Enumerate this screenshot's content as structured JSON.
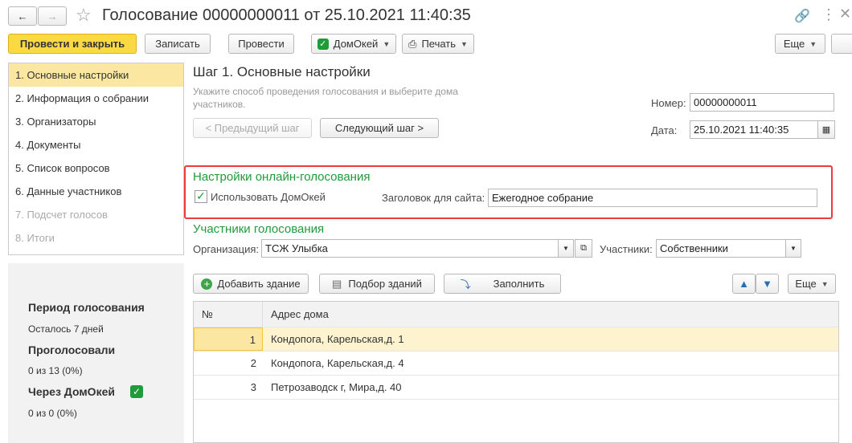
{
  "window": {
    "title": "Голосование 00000000011 от 25.10.2021 11:40:35"
  },
  "toolbar": {
    "post_close": "Провести и закрыть",
    "save": "Записать",
    "post": "Провести",
    "domokey": "ДомОкей",
    "print": "Печать",
    "more": "Еще"
  },
  "nav": {
    "items": [
      {
        "label": "1. Основные настройки"
      },
      {
        "label": "2. Информация о собрании"
      },
      {
        "label": "3. Организаторы"
      },
      {
        "label": "4. Документы"
      },
      {
        "label": "5. Список вопросов"
      },
      {
        "label": "6. Данные участников"
      },
      {
        "label": "7. Подсчет голосов"
      },
      {
        "label": "8. Итоги"
      }
    ]
  },
  "summary": {
    "period_title": "Период голосования",
    "period_value": "Осталось 7 дней",
    "voted_title": "Проголосовали",
    "voted_value": "0 из 13 (0%)",
    "via_title": "Через ДомОкей",
    "via_value": "0 из 0 (0%)"
  },
  "step": {
    "title": "Шаг 1. Основные настройки",
    "hint": "Укажите способ проведения голосования и выберите дома участников.",
    "prev": "< Предыдущий шаг",
    "next": "Следующий шаг >"
  },
  "doc": {
    "number_label": "Номер:",
    "number_value": "00000000011",
    "date_label": "Дата:",
    "date_value": "25.10.2021 11:40:35"
  },
  "online": {
    "title": "Настройки онлайн-голосования",
    "use_label": "Использовать ДомОкей",
    "use_checked": true,
    "header_label": "Заголовок для сайта:",
    "header_value": "Ежегодное собрание"
  },
  "participants": {
    "title": "Участники голосования",
    "org_label": "Организация:",
    "org_value": "ТСЖ Улыбка",
    "members_label": "Участники:",
    "members_value": "Собственники"
  },
  "table_toolbar": {
    "add": "Добавить здание",
    "select": "Подбор зданий",
    "fill": "Заполнить",
    "more": "Еще"
  },
  "table": {
    "headers": [
      "№",
      "Адрес дома"
    ],
    "rows": [
      {
        "n": "1",
        "address": "Кондопога, Карельская,д. 1"
      },
      {
        "n": "2",
        "address": "Кондопога, Карельская,д. 4"
      },
      {
        "n": "3",
        "address": "Петрозаводск г, Мира,д. 40"
      }
    ]
  },
  "colors": {
    "accent": "#fbd942",
    "green": "#1f9b3a",
    "highlight": "#ec3b3b",
    "selected_row": "#fdf4cf"
  }
}
